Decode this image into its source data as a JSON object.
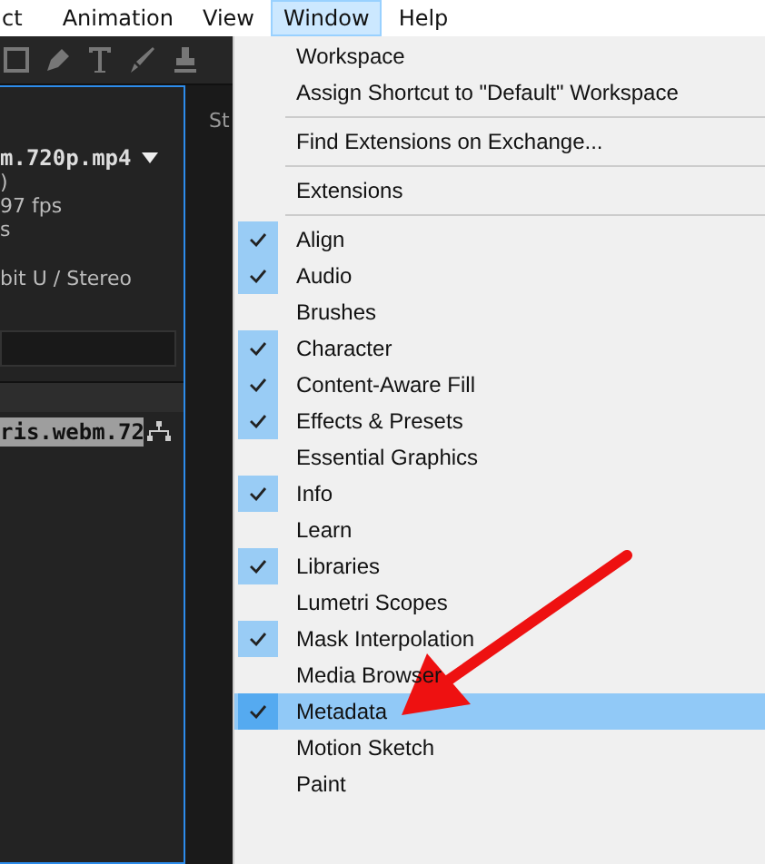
{
  "menu_bar": [
    {
      "label": "ct",
      "selected": false
    },
    {
      "label": "Animation",
      "selected": false
    },
    {
      "label": "View",
      "selected": false
    },
    {
      "label": "Window",
      "selected": true
    },
    {
      "label": "Help",
      "selected": false
    }
  ],
  "panel": {
    "tab": "St",
    "file_name": "m.720p.mp4",
    "info_lines": [
      ")",
      "97 fps",
      "s"
    ],
    "audio": "bit U / Stereo",
    "selected_item": "ris.webm.72"
  },
  "window_menu": [
    {
      "kind": "item",
      "label": "Workspace",
      "checked": false,
      "selected": false
    },
    {
      "kind": "item",
      "label": "Assign Shortcut to \"Default\" Workspace",
      "checked": false,
      "selected": false
    },
    {
      "kind": "separator"
    },
    {
      "kind": "item",
      "label": "Find Extensions on Exchange...",
      "checked": false,
      "selected": false
    },
    {
      "kind": "separator"
    },
    {
      "kind": "item",
      "label": "Extensions",
      "checked": false,
      "selected": false
    },
    {
      "kind": "separator"
    },
    {
      "kind": "item",
      "label": "Align",
      "checked": true,
      "selected": false
    },
    {
      "kind": "item",
      "label": "Audio",
      "checked": true,
      "selected": false
    },
    {
      "kind": "item",
      "label": "Brushes",
      "checked": false,
      "selected": false
    },
    {
      "kind": "item",
      "label": "Character",
      "checked": true,
      "selected": false
    },
    {
      "kind": "item",
      "label": "Content-Aware Fill",
      "checked": true,
      "selected": false
    },
    {
      "kind": "item",
      "label": "Effects & Presets",
      "checked": true,
      "selected": false
    },
    {
      "kind": "item",
      "label": "Essential Graphics",
      "checked": false,
      "selected": false
    },
    {
      "kind": "item",
      "label": "Info",
      "checked": true,
      "selected": false
    },
    {
      "kind": "item",
      "label": "Learn",
      "checked": false,
      "selected": false
    },
    {
      "kind": "item",
      "label": "Libraries",
      "checked": true,
      "selected": false
    },
    {
      "kind": "item",
      "label": "Lumetri Scopes",
      "checked": false,
      "selected": false
    },
    {
      "kind": "item",
      "label": "Mask Interpolation",
      "checked": true,
      "selected": false
    },
    {
      "kind": "item",
      "label": "Media Browser",
      "checked": false,
      "selected": false
    },
    {
      "kind": "item",
      "label": "Metadata",
      "checked": true,
      "selected": true
    },
    {
      "kind": "item",
      "label": "Motion Sketch",
      "checked": false,
      "selected": false
    },
    {
      "kind": "item",
      "label": "Paint",
      "checked": false,
      "selected": false
    }
  ]
}
